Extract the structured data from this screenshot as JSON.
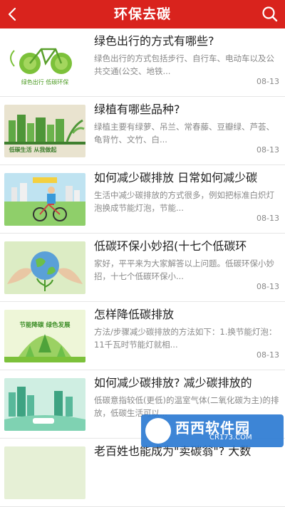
{
  "header": {
    "title": "环保去碳",
    "back_icon": "chevron-left-icon",
    "search_icon": "search-icon",
    "color": "#d9231d"
  },
  "articles": [
    {
      "title": "绿色出行的方式有哪些?",
      "desc": "绿色出行的方式包括步行、自行车、电动车以及公共交通(公交、地铁...",
      "date": "08-13",
      "image_text": "绿色出行 低碳环保"
    },
    {
      "title": "绿植有哪些品种?",
      "desc": "绿植主要有绿萝、吊兰、常春藤、豆瓣绿、芦荟、龟背竹、文竹、白...",
      "date": "08-13",
      "image_text": "低碳生活 从我做起"
    },
    {
      "title": "如何减少碳排放 日常如何减少碳",
      "desc": "生活中减少碳排放的方式很多，例如把标准白炽灯泡换成节能灯泡，节能...",
      "date": "08-13",
      "image_text": ""
    },
    {
      "title": "低碳环保小妙招(十七个低碳环",
      "desc": "家好，平平来为大家解答以上问题。低碳环保小妙招，十七个低碳环保小...",
      "date": "08-13",
      "image_text": ""
    },
    {
      "title": "怎样降低碳排放",
      "desc": "方法/步骤减少碳排放的方法如下：1.换节能灯泡：11千瓦时节能灯就相...",
      "date": "08-13",
      "image_text": "节能降碳 绿色发展"
    },
    {
      "title": "如何减少碳排放? 减少碳排放的",
      "desc": "低碳意指较低(更低)的温室气体(二氧化碳为主)的排放，低碳生活可以...",
      "date": "",
      "image_text": ""
    },
    {
      "title": "老百姓也能成为\"卖碳翁\"? 大数",
      "desc": "",
      "date": "",
      "image_text": ""
    }
  ],
  "watermark": {
    "text": "西西软件园",
    "sub": "CR173.COM"
  }
}
